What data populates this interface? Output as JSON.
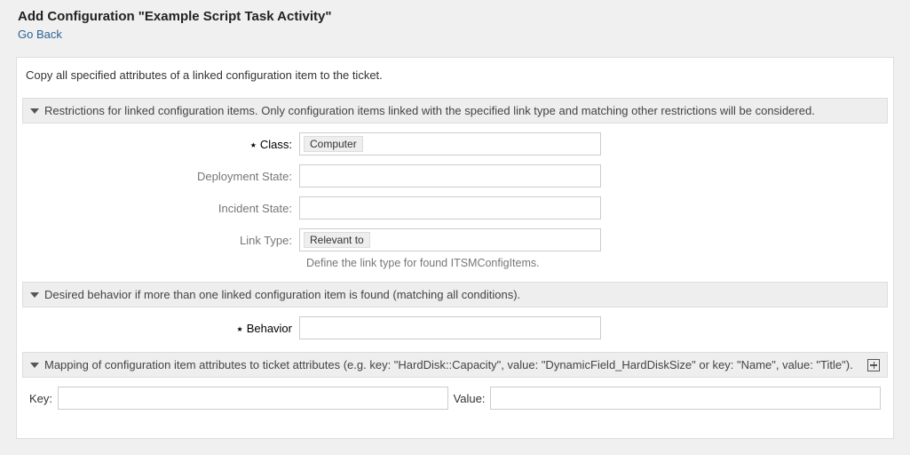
{
  "header": {
    "title": "Add Configuration \"Example Script Task Activity\"",
    "go_back": "Go Back"
  },
  "intro": "Copy all specified attributes of a linked configuration item to the ticket.",
  "sections": {
    "restrictions": {
      "title": "Restrictions for linked configuration items. Only configuration items linked with the specified link type and matching other restrictions will be considered.",
      "fields": {
        "class": {
          "label": "Class:",
          "value": "Computer"
        },
        "deployment_state": {
          "label": "Deployment State:",
          "value": ""
        },
        "incident_state": {
          "label": "Incident State:",
          "value": ""
        },
        "link_type": {
          "label": "Link Type:",
          "value": "Relevant to",
          "hint": "Define the link type for found ITSMConfigItems."
        }
      }
    },
    "behavior": {
      "title": "Desired behavior if more than one linked configuration item is found (matching all conditions).",
      "fields": {
        "behavior": {
          "label": "Behavior",
          "value": ""
        }
      }
    },
    "mapping": {
      "title": "Mapping of configuration item attributes to ticket attributes (e.g. key: \"HardDisk::Capacity\", value: \"DynamicField_HardDiskSize\" or key: \"Name\", value: \"Title\").",
      "key_label": "Key:",
      "value_label": "Value:",
      "key": "",
      "value": ""
    }
  }
}
